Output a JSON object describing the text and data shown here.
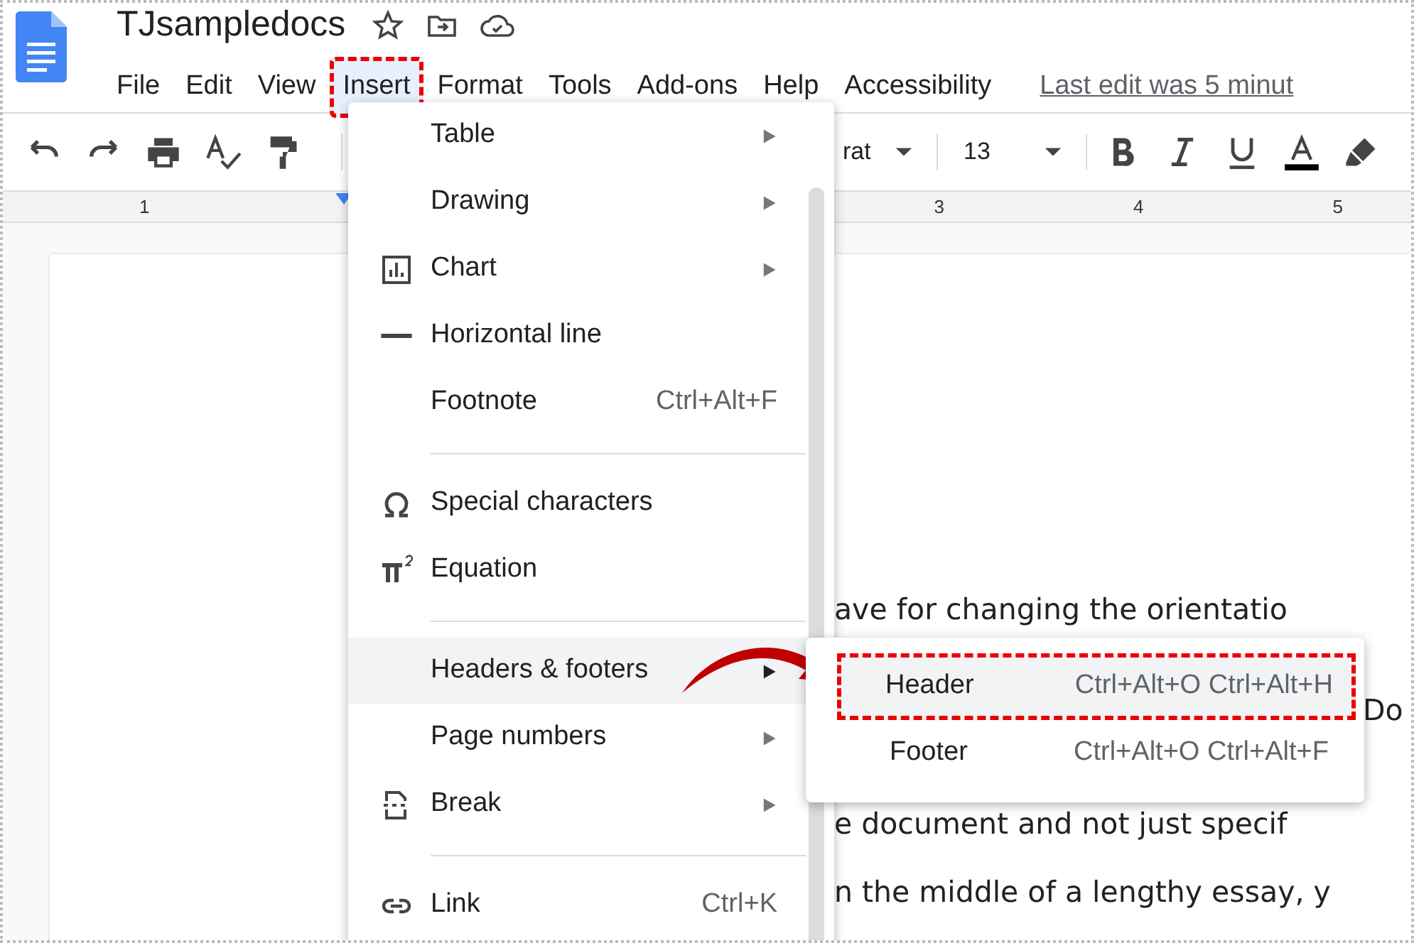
{
  "doc": {
    "title": "TJsampledocs"
  },
  "menu_bar": [
    {
      "label": "File",
      "selected": false,
      "callout": false
    },
    {
      "label": "Edit",
      "selected": false,
      "callout": false
    },
    {
      "label": "View",
      "selected": false,
      "callout": false
    },
    {
      "label": "Insert",
      "selected": true,
      "callout": true
    },
    {
      "label": "Format",
      "selected": false,
      "callout": false
    },
    {
      "label": "Tools",
      "selected": false,
      "callout": false
    },
    {
      "label": "Add-ons",
      "selected": false,
      "callout": false
    },
    {
      "label": "Help",
      "selected": false,
      "callout": false
    },
    {
      "label": "Accessibility",
      "selected": false,
      "callout": false
    }
  ],
  "last_edit": "Last edit was 5 minut",
  "toolbar": {
    "font": "rat",
    "font_size": "13"
  },
  "ruler": [
    "1",
    "3",
    "4",
    "5"
  ],
  "body_lines": [
    "ave for changing the orientatio",
    "Do",
    "e document and not just specif",
    "n the middle of a lengthy essay, y"
  ],
  "insert_menu": [
    [
      {
        "kind": "plain",
        "label": "Table",
        "has_submenu": true,
        "highlighted": false
      },
      {
        "kind": "plain",
        "label": "Drawing",
        "has_submenu": true,
        "highlighted": false
      },
      {
        "kind": "chart",
        "label": "Chart",
        "has_submenu": true,
        "highlighted": false
      },
      {
        "kind": "rule",
        "label": "Horizontal line",
        "has_submenu": false,
        "highlighted": false
      },
      {
        "kind": "plain",
        "label": "Footnote",
        "shortcut": "Ctrl+Alt+F",
        "has_submenu": false,
        "highlighted": false
      }
    ],
    [
      {
        "kind": "omega",
        "label": "Special characters",
        "has_submenu": false,
        "highlighted": false
      },
      {
        "kind": "pi",
        "label": "Equation",
        "has_submenu": false,
        "highlighted": false
      }
    ],
    [
      {
        "kind": "plain",
        "label": "Headers & footers",
        "has_submenu": true,
        "highlighted": true
      },
      {
        "kind": "plain",
        "label": "Page numbers",
        "has_submenu": true,
        "highlighted": false
      },
      {
        "kind": "break",
        "label": "Break",
        "has_submenu": true,
        "highlighted": false
      }
    ],
    [
      {
        "kind": "link",
        "label": "Link",
        "shortcut": "Ctrl+K",
        "has_submenu": false,
        "highlighted": false
      }
    ]
  ],
  "submenu": [
    {
      "label": "Header",
      "shortcut": "Ctrl+Alt+O Ctrl+Alt+H",
      "highlighted": true,
      "callout": true
    },
    {
      "label": "Footer",
      "shortcut": "Ctrl+Alt+O Ctrl+Alt+F",
      "highlighted": false,
      "callout": false
    }
  ]
}
